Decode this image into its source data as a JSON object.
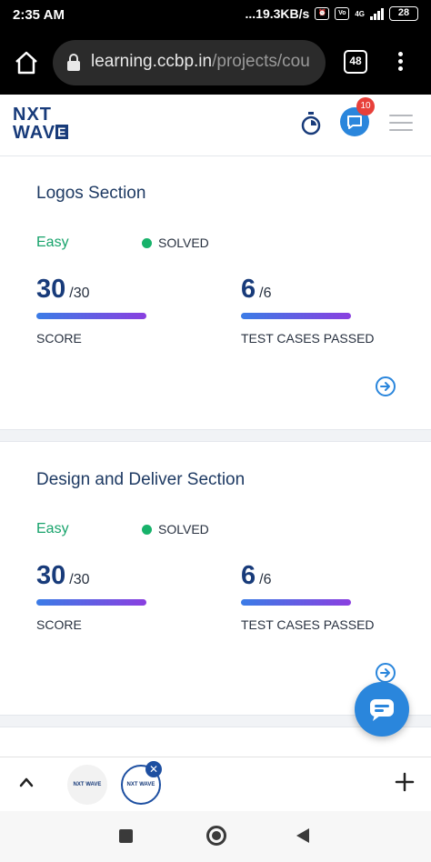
{
  "status_bar": {
    "time": "2:35 AM",
    "network_speed": "...19.3KB/s",
    "network_type": "4G",
    "battery": "28"
  },
  "browser": {
    "url_host": "learning.ccbp.in",
    "url_path": "/projects/cou",
    "tab_count": "48"
  },
  "header": {
    "logo_line1": "NXT",
    "logo_line2": "WAV",
    "logo_line2_boxed": "E",
    "notification_count": "10"
  },
  "cards": [
    {
      "title": "Logos Section",
      "difficulty": "Easy",
      "status": "SOLVED",
      "score": "30",
      "score_max": "/30",
      "score_label": "SCORE",
      "tests": "6",
      "tests_max": "/6",
      "tests_label": "TEST CASES PASSED"
    },
    {
      "title": "Design and Deliver Section",
      "difficulty": "Easy",
      "status": "SOLVED",
      "score": "30",
      "score_max": "/30",
      "score_label": "SCORE",
      "tests": "6",
      "tests_max": "/6",
      "tests_label": "TEST CASES PASSED"
    }
  ],
  "tab_strip": {
    "thumb_label": "NXT WAVE"
  },
  "colors": {
    "brand_navy": "#183b7a",
    "accent_blue": "#2a86dc",
    "easy_green": "#17a36b",
    "solved_dot": "#17b26a",
    "badge_red": "#e8403a"
  }
}
